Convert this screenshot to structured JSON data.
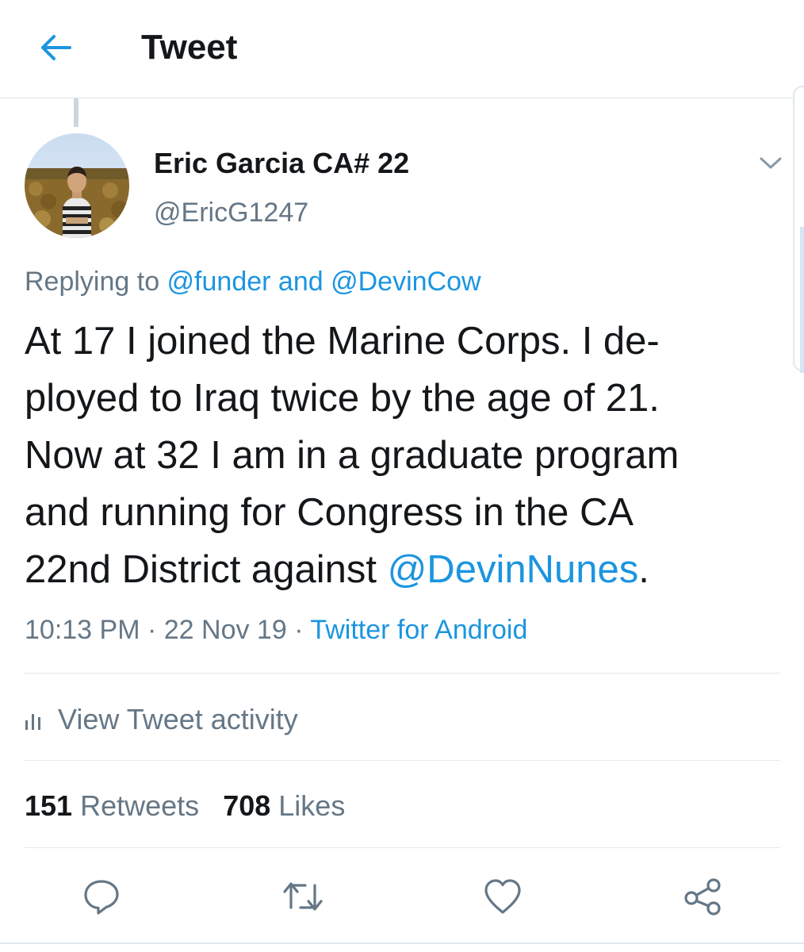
{
  "header": {
    "title": "Tweet",
    "back_icon": "arrow-left-icon"
  },
  "tweet": {
    "author": {
      "display_name": "Eric Garcia CA# 22",
      "handle": "@EricG1247",
      "avatar": "profile-photo"
    },
    "replying": {
      "prefix": "Replying to ",
      "user1": "@funder",
      "conjunction": " and ",
      "user2": "@DevinCow"
    },
    "text_lines": [
      "At 17 I joined the Marine Corps. I de-",
      "ployed to Iraq twice by the age of 21.",
      "Now at 32 I am in a graduate program",
      "and running for Congress in the CA"
    ],
    "last_line_prefix": "22nd District against ",
    "mention": "@DevinNunes",
    "last_line_suffix": ".",
    "time": "10:13 PM",
    "separator": " · ",
    "date": "22 Nov 19",
    "source": "Twitter for Android"
  },
  "activity": {
    "label": "View Tweet activity",
    "icon": "analytics-bars-icon"
  },
  "stats": {
    "retweets_count": "151",
    "retweets_label": "Retweets",
    "likes_count": "708",
    "likes_label": "Likes"
  },
  "actions": {
    "reply_icon": "reply-icon",
    "retweet_icon": "retweet-icon",
    "like_icon": "heart-icon",
    "share_icon": "share-icon"
  },
  "colors": {
    "accent": "#1b95e0",
    "secondary_text": "#657786",
    "primary_text": "#14171a",
    "divider": "#e1e8ed"
  }
}
